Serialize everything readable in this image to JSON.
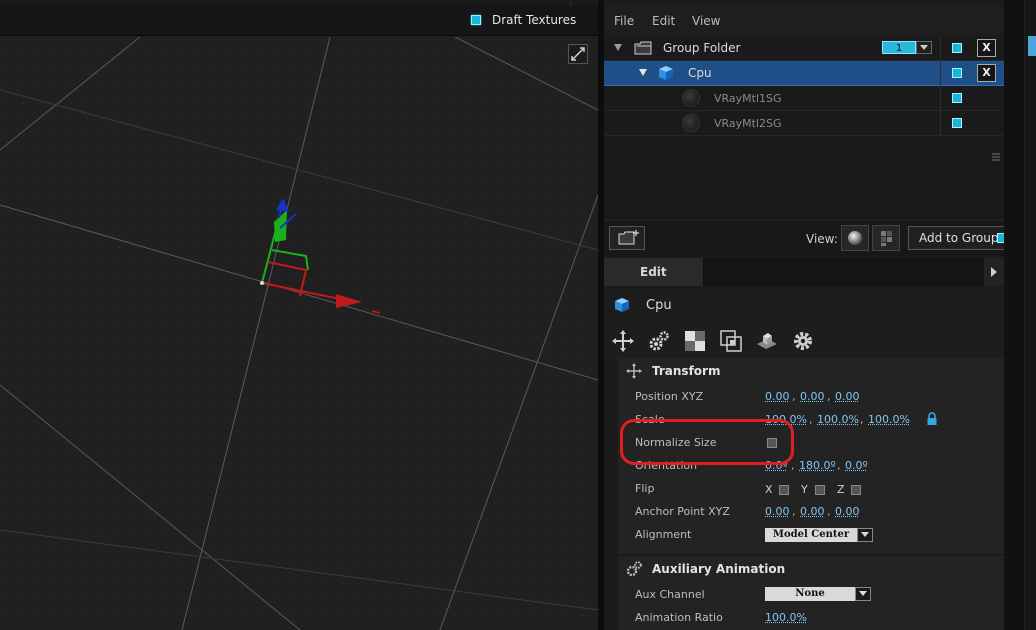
{
  "viewport": {
    "draft_textures_label": "Draft Textures"
  },
  "menu": [
    "File",
    "Edit",
    "View"
  ],
  "tree": {
    "group_folder": {
      "label": "Group Folder",
      "badge": "1"
    },
    "cpu": {
      "label": "Cpu"
    },
    "materials": [
      "VRayMtl1SG",
      "VRayMtl2SG"
    ],
    "x_label": "X"
  },
  "group_bar": {
    "view_label": "View:",
    "add_to_group": "Add to Group"
  },
  "edit_tab": {
    "label": "Edit"
  },
  "object": {
    "name": "Cpu"
  },
  "transform": {
    "title": "Transform",
    "position_label": "Position XYZ",
    "position": [
      "0.00",
      "0.00",
      "0.00"
    ],
    "scale_label": "Scale",
    "scale": [
      "100.0%",
      "100.0%",
      "100.0%"
    ],
    "normalize_label": "Normalize Size",
    "orientation_label": "Orientation",
    "orientation": [
      "0.0º",
      "180.0º",
      "0.0º"
    ],
    "flip_label": "Flip",
    "flip_axes": [
      "X",
      "Y",
      "Z"
    ],
    "anchor_label": "Anchor Point XYZ",
    "anchor": [
      "0.00",
      "0.00",
      "0.00"
    ],
    "alignment_label": "Alignment",
    "alignment_value": "Model Center",
    "comma": ","
  },
  "aux": {
    "title": "Auxiliary Animation",
    "channel_label": "Aux Channel",
    "channel_value": "None",
    "ratio_label": "Animation Ratio",
    "ratio_value": "100.0%"
  },
  "colors": {
    "accent": "#17b7d8",
    "selection": "#1f4f86",
    "value_link": "#7fc6f4",
    "callout": "#e02020"
  }
}
